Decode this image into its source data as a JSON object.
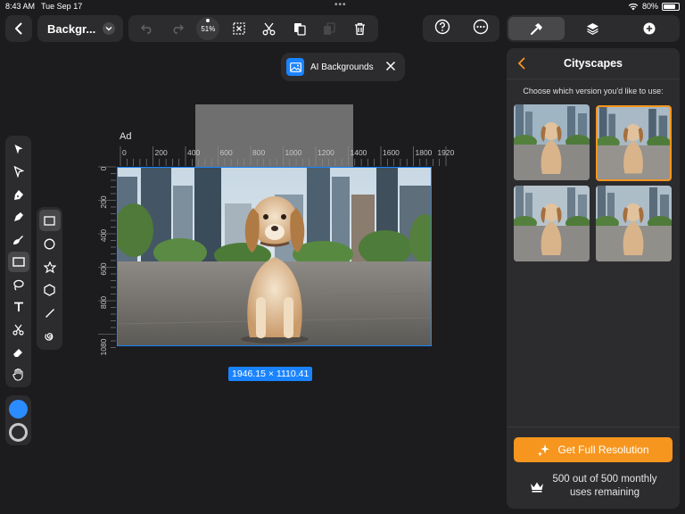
{
  "status_bar": {
    "time": "8:43 AM",
    "date": "Tue Sep 17",
    "battery": "80%",
    "battery_level": 0.8
  },
  "toolbar": {
    "document_title": "Backgr...",
    "zoom_level": "51%"
  },
  "ai_pill": {
    "label": "AI Backgrounds"
  },
  "canvas": {
    "artboard_label": "Ad",
    "ruler_h": [
      "0",
      "200",
      "400",
      "600",
      "800",
      "1000",
      "1200",
      "1400",
      "1600",
      "1800",
      "1920"
    ],
    "ruler_v": [
      "0",
      "200",
      "400",
      "600",
      "800",
      "1080"
    ],
    "dimensions": "1946.15 × 1110.41"
  },
  "panel": {
    "title": "Cityscapes",
    "prompt": "Choose which version you'd like to use:",
    "selected_index": 1,
    "cta_label": "Get Full Resolution",
    "usage_line1": "500 out of 500 monthly",
    "usage_line2": "uses remaining"
  },
  "colors": {
    "accent": "#1a84ff",
    "cta": "#f7961e",
    "fill_swatch": "#2a8cff"
  }
}
